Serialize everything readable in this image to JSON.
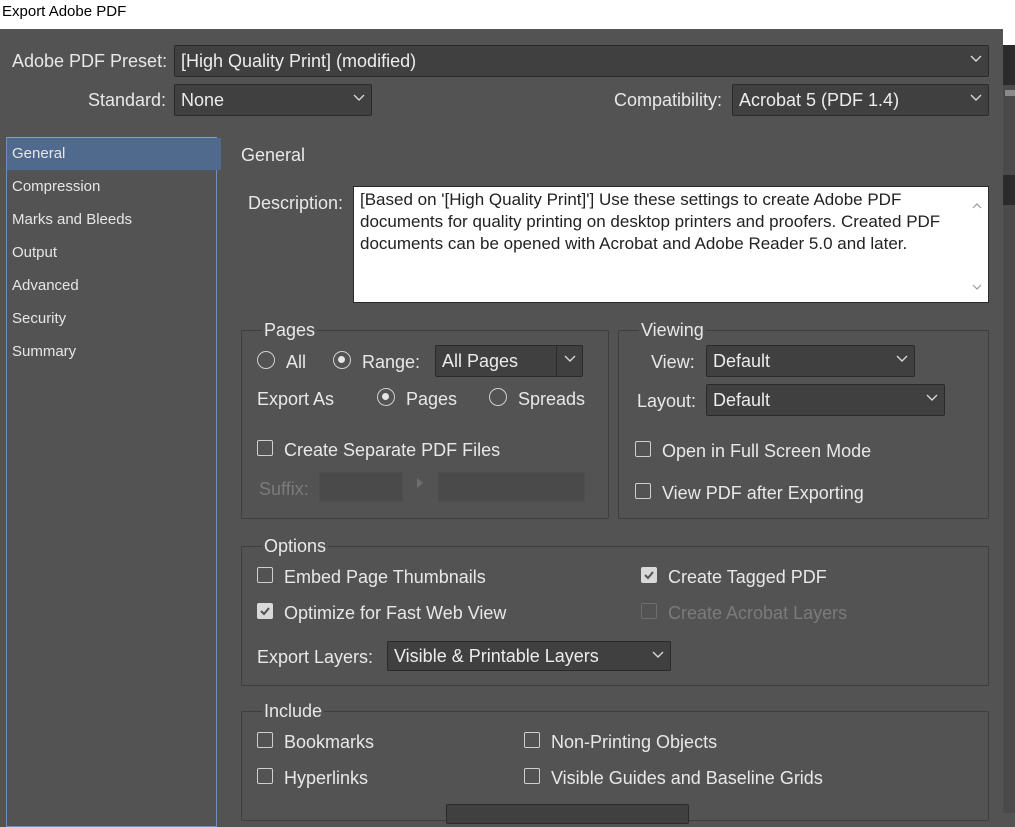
{
  "window": {
    "title": "Export Adobe PDF"
  },
  "preset": {
    "label": "Adobe PDF Preset:",
    "value": "[High Quality Print] (modified)"
  },
  "standard": {
    "label": "Standard:",
    "value": "None"
  },
  "compatibility": {
    "label": "Compatibility:",
    "value": "Acrobat 5 (PDF 1.4)"
  },
  "sidebar": {
    "items": [
      {
        "label": "General"
      },
      {
        "label": "Compression"
      },
      {
        "label": "Marks and Bleeds"
      },
      {
        "label": "Output"
      },
      {
        "label": "Advanced"
      },
      {
        "label": "Security"
      },
      {
        "label": "Summary"
      }
    ]
  },
  "general": {
    "heading": "General",
    "description_label": "Description:",
    "description_text": "[Based on '[High Quality Print]'] Use these settings to create Adobe PDF documents for quality printing on desktop printers and proofers.  Created PDF documents can be opened with Acrobat and Adobe Reader 5.0 and later."
  },
  "pages": {
    "title": "Pages",
    "all_label": "All",
    "range_label": "Range:",
    "range_value": "All Pages",
    "export_as_label": "Export As",
    "pages_label": "Pages",
    "spreads_label": "Spreads",
    "separate_files_label": "Create Separate PDF Files",
    "suffix_label": "Suffix:"
  },
  "viewing": {
    "title": "Viewing",
    "view_label": "View:",
    "view_value": "Default",
    "layout_label": "Layout:",
    "layout_value": "Default",
    "full_screen_label": "Open in Full Screen Mode",
    "view_after_label": "View PDF after Exporting"
  },
  "options": {
    "title": "Options",
    "embed_thumbnails_label": "Embed Page Thumbnails",
    "tagged_pdf_label": "Create Tagged PDF",
    "fast_web_label": "Optimize for Fast Web View",
    "acrobat_layers_label": "Create Acrobat Layers",
    "export_layers_label": "Export Layers:",
    "export_layers_value": "Visible & Printable Layers"
  },
  "include": {
    "title": "Include",
    "bookmarks_label": "Bookmarks",
    "non_printing_label": "Non-Printing Objects",
    "hyperlinks_label": "Hyperlinks",
    "guides_label": "Visible Guides and Baseline Grids"
  },
  "colors": {
    "panel": "#535353",
    "selection": "#506a8e",
    "field": "#404040"
  }
}
